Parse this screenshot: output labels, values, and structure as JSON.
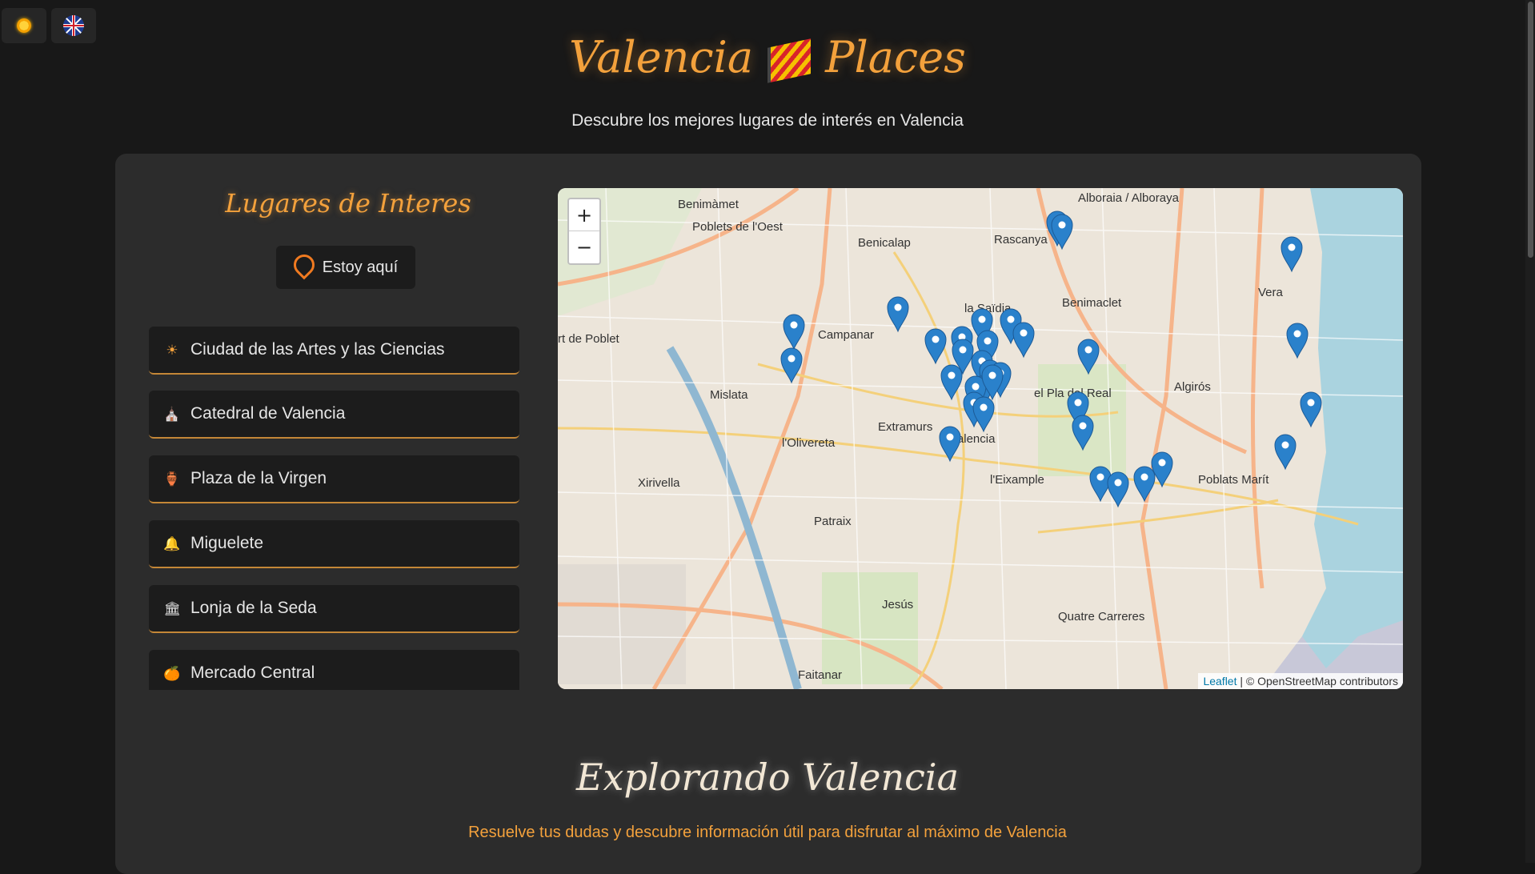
{
  "header": {
    "title_part1": "Valencia",
    "title_part2": "Places",
    "subtitle": "Descubre los mejores lugares de interés en Valencia"
  },
  "topbar": {
    "theme_icon": "sun-icon",
    "language_icon": "uk-flag-icon"
  },
  "sidebar": {
    "title": "Lugares de Interes",
    "locate_button": "Estoy aquí",
    "items": [
      {
        "icon": "☀",
        "icon_name": "sun-icon",
        "label": "Ciudad de las Artes y las Ciencias"
      },
      {
        "icon": "⛪",
        "icon_name": "cathedral-icon",
        "label": "Catedral de Valencia"
      },
      {
        "icon": "🏺",
        "icon_name": "amphora-icon",
        "label": "Plaza de la Virgen"
      },
      {
        "icon": "🔔",
        "icon_name": "bell-icon",
        "label": "Miguelete"
      },
      {
        "icon": "🏛",
        "icon_name": "building-icon",
        "label": "Lonja de la Seda"
      },
      {
        "icon": "🍊",
        "icon_name": "orange-icon",
        "label": "Mercado Central"
      }
    ]
  },
  "map": {
    "zoom_in": "+",
    "zoom_out": "−",
    "attribution_leaflet": "Leaflet",
    "attribution_rest": "| © OpenStreetMap contributors",
    "labels": [
      "Benimàmet",
      "Poblets de l'Oest",
      "Benicalap",
      "Rascanya",
      "Alboraia / Alboraya",
      "Vera",
      "la Saïdia",
      "Benimaclet",
      "Campanar",
      "rt de Poblet",
      "Mislata",
      "Extramurs",
      "el Pla del Real",
      "Algirós",
      "l'Olivereta",
      "Valencia",
      "Xirivella",
      "l'Eixample",
      "Poblats Marít",
      "Patraix",
      "Jesús",
      "Quatre Carreres",
      "Faitanar"
    ]
  },
  "explore": {
    "title": "Explorando Valencia",
    "subtitle": "Resuelve tus dudas y descubre información útil para disfrutar al máximo de Valencia"
  },
  "colors": {
    "accent": "#f3a13c",
    "background": "#181818",
    "panel": "#2c2c2c",
    "item": "#1c1c1c",
    "marker": "#2a81cb"
  }
}
